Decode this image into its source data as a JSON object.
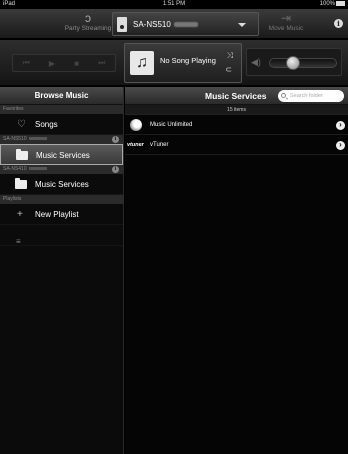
{
  "status_bar": {
    "device": "iPad",
    "time": "1:51 PM",
    "battery": "100%"
  },
  "top_bar": {
    "party_label": "Party Streaming",
    "device_name": "SA-NS510",
    "move_label": "Move Music"
  },
  "player": {
    "now_playing": "No Song Playing",
    "volume_level": 0.3
  },
  "sidebar": {
    "title": "Browse Music",
    "favorites_label": "Favorites",
    "songs_label": "Songs",
    "device1_label": "SA-NS510",
    "music_services_1": "Music Services",
    "device2_label": "SA-NS410",
    "music_services_2": "Music Services",
    "playlists_label": "Playlists",
    "new_playlist": "New Playlist"
  },
  "main": {
    "title": "Music Services",
    "search_placeholder": "Search folder",
    "count": "15 items",
    "items": [
      {
        "label": "Music Unlimited",
        "logo": "music-unlimited-logo"
      },
      {
        "label": "vTuner",
        "logo_text": "vtuner"
      }
    ]
  }
}
